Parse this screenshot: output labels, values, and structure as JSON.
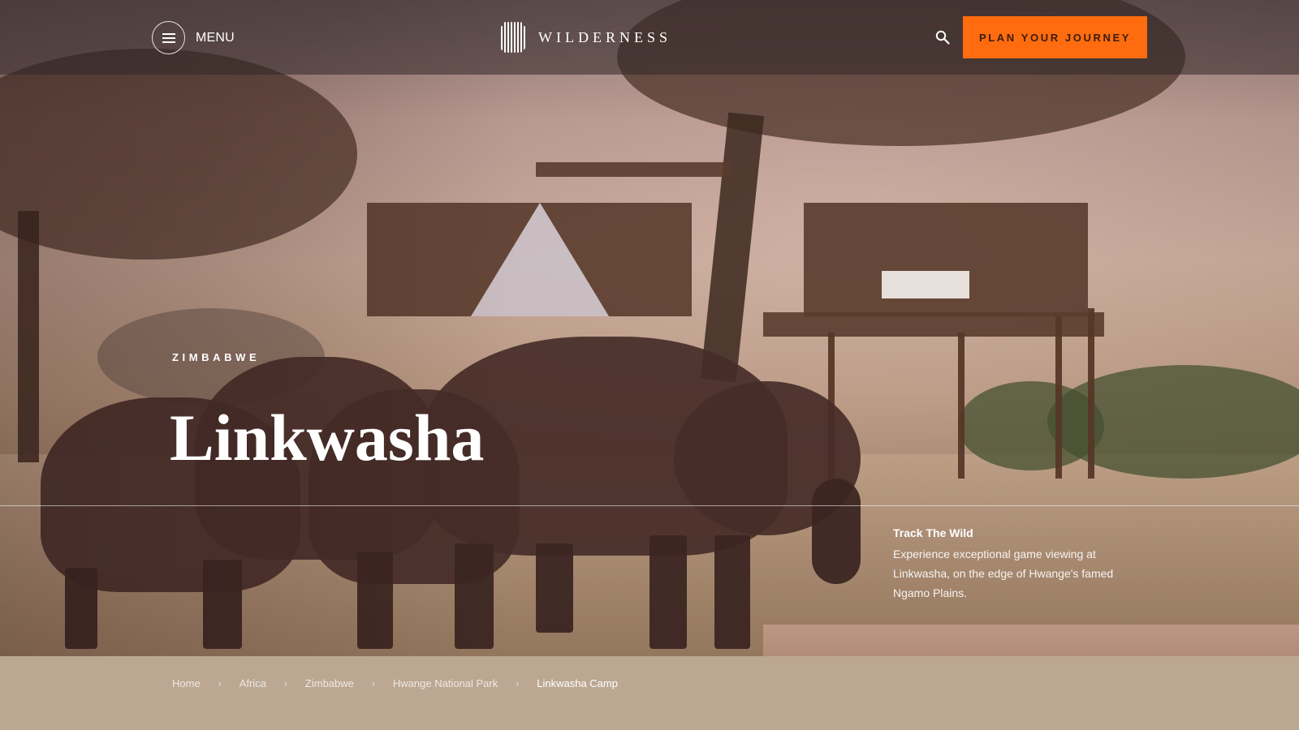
{
  "header": {
    "menu_label": "MENU",
    "logo_text": "WILDERNESS",
    "cta_label": "PLAN YOUR JOURNEY",
    "icons": {
      "menu": "hamburger-icon",
      "search": "search-icon",
      "logo": "wilderness-logo-mark"
    }
  },
  "hero": {
    "country": "ZIMBABWE",
    "title": "Linkwasha",
    "feature": {
      "title": "Track The Wild",
      "body": "Experience exceptional game viewing at Linkwasha, on the edge of Hwange's famed Ngamo Plains."
    }
  },
  "breadcrumb": {
    "items": [
      "Home",
      "Africa",
      "Zimbabwe",
      "Hwange National Park",
      "Linkwasha Camp"
    ],
    "separator": "›"
  },
  "colors": {
    "accent": "#ff6c0f",
    "footer_band": "#bca792"
  }
}
